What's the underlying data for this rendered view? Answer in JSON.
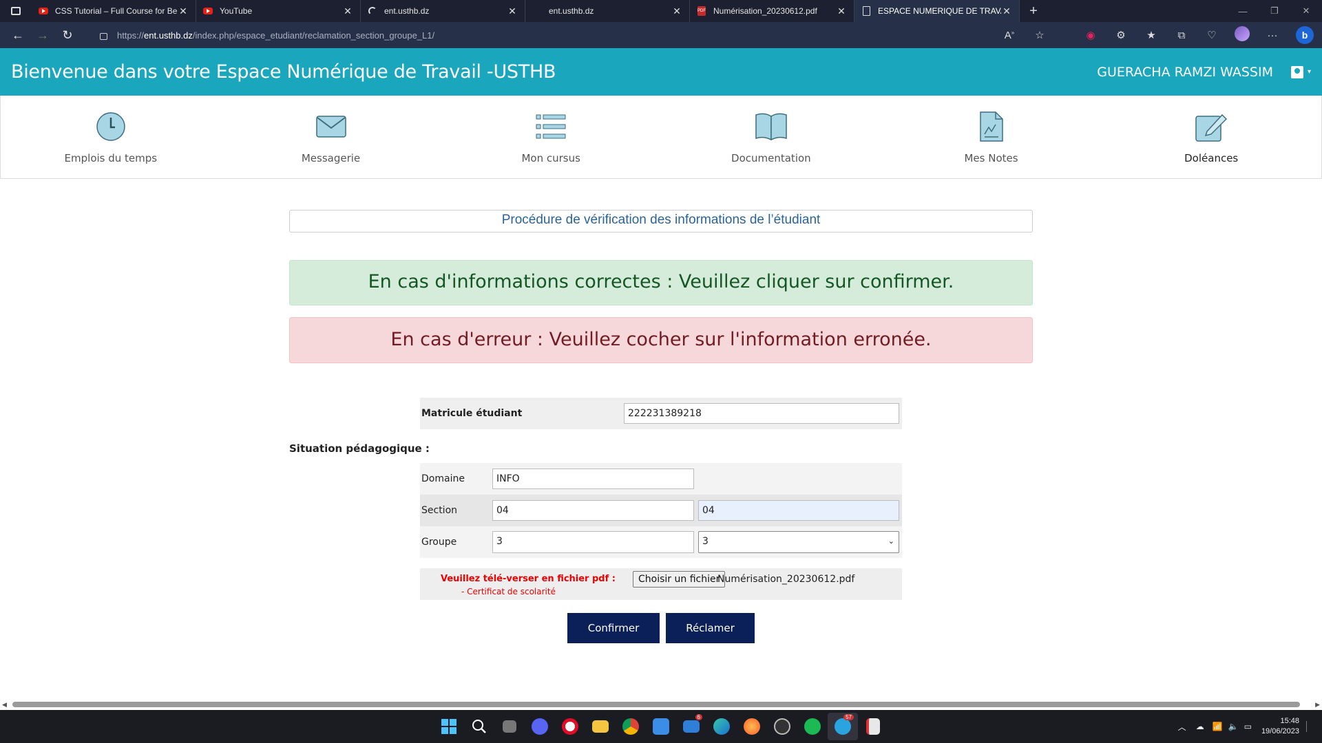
{
  "browser": {
    "tabs": [
      {
        "title": "CSS Tutorial – Full Course for Be",
        "icon": "youtube-icon"
      },
      {
        "title": "YouTube",
        "icon": "youtube-icon"
      },
      {
        "title": "ent.usthb.dz",
        "icon": "loading-icon"
      },
      {
        "title": "ent.usthb.dz",
        "icon": "none"
      },
      {
        "title": "Numérisation_20230612.pdf",
        "icon": "pdf-icon"
      },
      {
        "title": "ESPACE NUMERIQUE DE TRAVAIL",
        "icon": "document-icon"
      }
    ],
    "url_scheme": "https://",
    "url_host": "ent.usthb.dz",
    "url_path": "/index.php/espace_etudiant/reclamation_section_groupe_L1/"
  },
  "header": {
    "title": "Bienvenue dans votre Espace Numérique de Travail -USTHB",
    "user_name": "GUERACHA RAMZI WASSIM"
  },
  "nav": {
    "items": [
      {
        "label": "Emplois du temps",
        "icon": "clock-icon"
      },
      {
        "label": "Messagerie",
        "icon": "envelope-icon"
      },
      {
        "label": "Mon cursus",
        "icon": "list-icon"
      },
      {
        "label": "Documentation",
        "icon": "book-icon"
      },
      {
        "label": "Mes Notes",
        "icon": "document-chart-icon"
      },
      {
        "label": "Doléances",
        "icon": "edit-icon"
      }
    ]
  },
  "main": {
    "procedure_title": "Procédure de vérification des informations de l’étudiant",
    "alert_success": "En cas d'informations correctes : Veuillez cliquer sur confirmer.",
    "alert_error": "En cas d'erreur : Veuillez cocher sur l'information erronée.",
    "matricule_label": "Matricule étudiant",
    "matricule_value": "222231389218",
    "situation_label": "Situation pédagogique :",
    "domaine_label": "Domaine",
    "domaine_value": "INFO",
    "section_label": "Section",
    "section_value": "04",
    "section_new_value": "04",
    "groupe_label": "Groupe",
    "groupe_value": "3",
    "groupe_select_value": "3",
    "upload_warning": "Veuillez télé-verser en fichier pdf :",
    "upload_doc": "- Certificat de scolarité",
    "file_button": "Choisir un fichier",
    "file_name": "Numérisation_20230612.pdf",
    "confirm_button": "Confirmer",
    "claim_button": "Réclamer"
  },
  "taskbar": {
    "time": "15:48",
    "date": "19/06/2023",
    "mail_badge": "6",
    "telegram_badge": "57"
  },
  "colors": {
    "header_bg": "#1aa6bd",
    "success_bg": "#d4ecd9",
    "error_bg": "#f6d7da",
    "button_bg": "#0b1f59"
  }
}
